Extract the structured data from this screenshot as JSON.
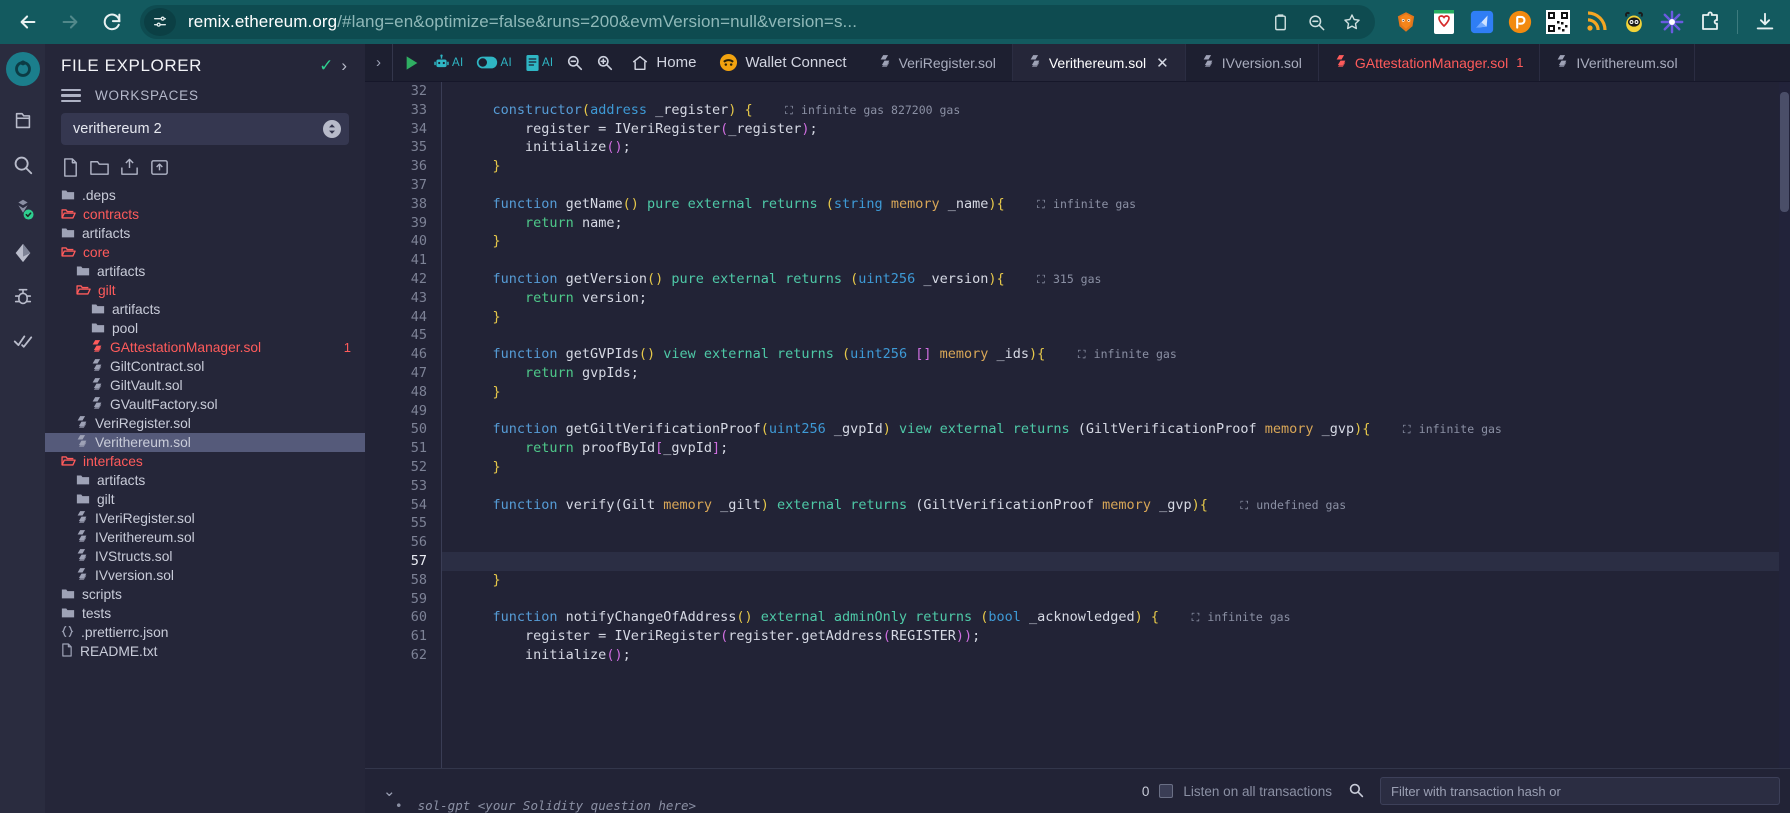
{
  "browser": {
    "back_icon": "back-arrow",
    "forward_icon": "forward-arrow",
    "reload_icon": "reload",
    "site_info_icon": "site-settings",
    "url_domain": "remix.ethereum.org",
    "url_path": "/#lang=en&optimize=false&runs=200&evmVersion=null&version=s...",
    "copy_icon": "clipboard",
    "zoom_icon": "zoom-out-magnifier",
    "bookmark_icon": "star",
    "extensions": [
      {
        "name": "metamask-extension",
        "glyph": "🦊"
      },
      {
        "name": "rabby-wallet-extension",
        "glyph": "🛡"
      },
      {
        "name": "bluefin-extension",
        "glyph": "➤"
      },
      {
        "name": "phantom-wallet-extension",
        "glyph": "℗"
      },
      {
        "name": "qr-code-extension",
        "glyph": "▓"
      },
      {
        "name": "rss-feed-extension",
        "glyph": "◔"
      },
      {
        "name": "bee-extension",
        "glyph": "🐝"
      },
      {
        "name": "asterisk-extension",
        "glyph": "✳"
      },
      {
        "name": "puzzle-extensions-menu",
        "glyph": "⧉"
      }
    ],
    "download_icon": "download"
  },
  "rail": {
    "items": [
      {
        "name": "remix-logo",
        "label": ""
      },
      {
        "name": "file-explorer-icon",
        "label": ""
      },
      {
        "name": "search-icon",
        "label": ""
      },
      {
        "name": "solidity-compiler-icon",
        "label": ""
      },
      {
        "name": "deploy-run-icon",
        "label": ""
      },
      {
        "name": "debugger-icon",
        "label": ""
      },
      {
        "name": "solidity-unit-testing-icon",
        "label": ""
      }
    ]
  },
  "explorer": {
    "title": "FILE EXPLORER",
    "check_icon": "check",
    "expand_icon": "chevron-right",
    "workspaces_label": "WORKSPACES",
    "workspace_selected": "verithereum 2",
    "actions": [
      {
        "name": "create-new-file-icon"
      },
      {
        "name": "create-new-folder-icon"
      },
      {
        "name": "publish-to-gist-icon"
      },
      {
        "name": "upload-file-icon"
      }
    ],
    "tree": [
      {
        "label": ".deps",
        "type": "folder",
        "depth": 0,
        "open": false,
        "state": "closed"
      },
      {
        "label": "contracts",
        "type": "folder",
        "depth": 0,
        "open": true,
        "state": "open"
      },
      {
        "label": "artifacts",
        "type": "folder",
        "depth": 1,
        "open": false,
        "state": "closed"
      },
      {
        "label": "core",
        "type": "folder",
        "depth": 1,
        "open": true,
        "state": "open"
      },
      {
        "label": "artifacts",
        "type": "folder",
        "depth": 2,
        "open": false,
        "state": "closed"
      },
      {
        "label": "gilt",
        "type": "folder",
        "depth": 2,
        "open": true,
        "state": "open"
      },
      {
        "label": "artifacts",
        "type": "folder",
        "depth": 3,
        "open": false,
        "state": "closed"
      },
      {
        "label": "pool",
        "type": "folder",
        "depth": 3,
        "open": false,
        "state": "closed"
      },
      {
        "label": "GAttestationManager.sol",
        "type": "sol",
        "depth": 3,
        "error": true,
        "badge": "1"
      },
      {
        "label": "GiltContract.sol",
        "type": "sol",
        "depth": 3
      },
      {
        "label": "GiltVault.sol",
        "type": "sol",
        "depth": 3
      },
      {
        "label": "GVaultFactory.sol",
        "type": "sol",
        "depth": 3
      },
      {
        "label": "VeriRegister.sol",
        "type": "sol",
        "depth": 2
      },
      {
        "label": "Verithereum.sol",
        "type": "sol",
        "depth": 2,
        "selected": true
      },
      {
        "label": "interfaces",
        "type": "folder",
        "depth": 1,
        "open": true,
        "state": "open"
      },
      {
        "label": "artifacts",
        "type": "folder",
        "depth": 2,
        "open": false,
        "state": "closed"
      },
      {
        "label": "gilt",
        "type": "folder",
        "depth": 2,
        "open": false,
        "state": "closed"
      },
      {
        "label": "IVeriRegister.sol",
        "type": "sol",
        "depth": 2
      },
      {
        "label": "IVerithereum.sol",
        "type": "sol",
        "depth": 2
      },
      {
        "label": "IVStructs.sol",
        "type": "sol",
        "depth": 2
      },
      {
        "label": "IVversion.sol",
        "type": "sol",
        "depth": 2
      },
      {
        "label": "scripts",
        "type": "folder",
        "depth": 0,
        "open": false,
        "state": "closed"
      },
      {
        "label": "tests",
        "type": "folder",
        "depth": 0,
        "open": false,
        "state": "closed"
      },
      {
        "label": ".prettierrc.json",
        "type": "json",
        "depth": 0
      },
      {
        "label": "README.txt",
        "type": "txt",
        "depth": 0
      }
    ]
  },
  "toolbar": {
    "panel_toggle_icon": "chevron-right",
    "run_label": "",
    "buttons": [
      {
        "name": "run-script-button",
        "icon": "play",
        "label": ""
      },
      {
        "name": "ai-explain-button",
        "icon": "robot",
        "label": "AI"
      },
      {
        "name": "ai-toggle-button",
        "icon": "toggle",
        "label": "AI"
      },
      {
        "name": "ai-docs-button",
        "icon": "book",
        "label": "AI"
      },
      {
        "name": "zoom-out-button",
        "icon": "zoom-out",
        "label": ""
      },
      {
        "name": "zoom-in-button",
        "icon": "zoom-in",
        "label": ""
      }
    ],
    "home_label": "Home",
    "wallet_connect_label": "Wallet Connect"
  },
  "tabs": [
    {
      "label": "VeriRegister.sol",
      "active": false,
      "error": false,
      "closable": false
    },
    {
      "label": "Verithereum.sol",
      "active": true,
      "error": false,
      "closable": true
    },
    {
      "label": "IVversion.sol",
      "active": false,
      "error": false,
      "closable": false
    },
    {
      "label": "GAttestationManager.sol",
      "active": false,
      "error": true,
      "closable": false,
      "badge": "1"
    },
    {
      "label": "IVerithereum.sol",
      "active": false,
      "error": false,
      "closable": false
    }
  ],
  "editor": {
    "first_line": 32,
    "current_line": 57,
    "lines": [
      {
        "n": 32,
        "tokens": []
      },
      {
        "n": 33,
        "tokens": [
          {
            "t": "    ",
            "c": "w"
          },
          {
            "t": "constructor",
            "c": "k"
          },
          {
            "t": "(",
            "c": "y"
          },
          {
            "t": "address",
            "c": "ty"
          },
          {
            "t": " _register",
            "c": "w"
          },
          {
            "t": ")",
            "c": "y"
          },
          {
            "t": " {",
            "c": "y"
          }
        ],
        "gas": "infinite gas 827200 gas"
      },
      {
        "n": 34,
        "tokens": [
          {
            "t": "        register ",
            "c": "w"
          },
          {
            "t": "= ",
            "c": "w"
          },
          {
            "t": "IVeriRegister",
            "c": "fn"
          },
          {
            "t": "(",
            "c": "p"
          },
          {
            "t": "_register",
            "c": "w"
          },
          {
            "t": ")",
            "c": "p"
          },
          {
            "t": ";",
            "c": "w"
          }
        ]
      },
      {
        "n": 35,
        "tokens": [
          {
            "t": "        initialize",
            "c": "w"
          },
          {
            "t": "()",
            "c": "p"
          },
          {
            "t": ";",
            "c": "w"
          }
        ]
      },
      {
        "n": 36,
        "tokens": [
          {
            "t": "    }",
            "c": "y"
          }
        ]
      },
      {
        "n": 37,
        "tokens": []
      },
      {
        "n": 38,
        "tokens": [
          {
            "t": "    ",
            "c": "w"
          },
          {
            "t": "function",
            "c": "k"
          },
          {
            "t": " getName",
            "c": "w"
          },
          {
            "t": "()",
            "c": "y"
          },
          {
            "t": " pure external returns ",
            "c": "kw"
          },
          {
            "t": "(",
            "c": "y"
          },
          {
            "t": "string",
            "c": "ty"
          },
          {
            "t": " memory",
            "c": "str"
          },
          {
            "t": " _name",
            "c": "w"
          },
          {
            "t": "){",
            "c": "y"
          }
        ],
        "gas": "infinite gas"
      },
      {
        "n": 39,
        "tokens": [
          {
            "t": "        ",
            "c": "w"
          },
          {
            "t": "return",
            "c": "g"
          },
          {
            "t": " name;",
            "c": "w"
          }
        ]
      },
      {
        "n": 40,
        "tokens": [
          {
            "t": "    }",
            "c": "y"
          }
        ]
      },
      {
        "n": 41,
        "tokens": []
      },
      {
        "n": 42,
        "tokens": [
          {
            "t": "    ",
            "c": "w"
          },
          {
            "t": "function",
            "c": "k"
          },
          {
            "t": " getVersion",
            "c": "w"
          },
          {
            "t": "()",
            "c": "y"
          },
          {
            "t": " pure external returns ",
            "c": "kw"
          },
          {
            "t": "(",
            "c": "y"
          },
          {
            "t": "uint256",
            "c": "ty"
          },
          {
            "t": " _version",
            "c": "w"
          },
          {
            "t": "){",
            "c": "y"
          }
        ],
        "gas": "315 gas"
      },
      {
        "n": 43,
        "tokens": [
          {
            "t": "        ",
            "c": "w"
          },
          {
            "t": "return",
            "c": "g"
          },
          {
            "t": " version;",
            "c": "w"
          }
        ]
      },
      {
        "n": 44,
        "tokens": [
          {
            "t": "    }",
            "c": "y"
          }
        ]
      },
      {
        "n": 45,
        "tokens": []
      },
      {
        "n": 46,
        "tokens": [
          {
            "t": "    ",
            "c": "w"
          },
          {
            "t": "function",
            "c": "k"
          },
          {
            "t": " getGVPIds",
            "c": "w"
          },
          {
            "t": "()",
            "c": "y"
          },
          {
            "t": " view external returns ",
            "c": "kw"
          },
          {
            "t": "(",
            "c": "y"
          },
          {
            "t": "uint256",
            "c": "ty"
          },
          {
            "t": " ",
            "c": "w"
          },
          {
            "t": "[]",
            "c": "p"
          },
          {
            "t": " memory",
            "c": "str"
          },
          {
            "t": " _ids",
            "c": "w"
          },
          {
            "t": "){",
            "c": "y"
          }
        ],
        "gas": "infinite gas"
      },
      {
        "n": 47,
        "tokens": [
          {
            "t": "        ",
            "c": "w"
          },
          {
            "t": "return",
            "c": "g"
          },
          {
            "t": " gvpIds;",
            "c": "w"
          }
        ]
      },
      {
        "n": 48,
        "tokens": [
          {
            "t": "    }",
            "c": "y"
          }
        ]
      },
      {
        "n": 49,
        "tokens": []
      },
      {
        "n": 50,
        "tokens": [
          {
            "t": "    ",
            "c": "w"
          },
          {
            "t": "function",
            "c": "k"
          },
          {
            "t": " getGiltVerificationProof",
            "c": "w"
          },
          {
            "t": "(",
            "c": "y"
          },
          {
            "t": "uint256",
            "c": "ty"
          },
          {
            "t": " _gvpId",
            "c": "w"
          },
          {
            "t": ")",
            "c": "y"
          },
          {
            "t": " view external returns ",
            "c": "kw"
          },
          {
            "t": "(GiltVerificationProof",
            "c": "w"
          },
          {
            "t": " memory",
            "c": "str"
          },
          {
            "t": " _gvp",
            "c": "w"
          },
          {
            "t": "){",
            "c": "y"
          }
        ],
        "gas": "infinite gas"
      },
      {
        "n": 51,
        "tokens": [
          {
            "t": "        ",
            "c": "w"
          },
          {
            "t": "return",
            "c": "g"
          },
          {
            "t": " proofById",
            "c": "w"
          },
          {
            "t": "[",
            "c": "p"
          },
          {
            "t": "_gvpId",
            "c": "w"
          },
          {
            "t": "]",
            "c": "p"
          },
          {
            "t": ";",
            "c": "w"
          }
        ]
      },
      {
        "n": 52,
        "tokens": [
          {
            "t": "    }",
            "c": "y"
          }
        ]
      },
      {
        "n": 53,
        "tokens": []
      },
      {
        "n": 54,
        "tokens": [
          {
            "t": "    ",
            "c": "w"
          },
          {
            "t": "function",
            "c": "k"
          },
          {
            "t": " verify",
            "c": "w"
          },
          {
            "t": "(Gilt",
            "c": "w"
          },
          {
            "t": " memory",
            "c": "str"
          },
          {
            "t": " _gilt",
            "c": "w"
          },
          {
            "t": ")",
            "c": "y"
          },
          {
            "t": " external returns ",
            "c": "kw"
          },
          {
            "t": "(GiltVerificationProof",
            "c": "w"
          },
          {
            "t": " memory",
            "c": "str"
          },
          {
            "t": " _gvp",
            "c": "w"
          },
          {
            "t": "){",
            "c": "y"
          }
        ],
        "gas": "undefined gas"
      },
      {
        "n": 55,
        "tokens": []
      },
      {
        "n": 56,
        "tokens": []
      },
      {
        "n": 57,
        "tokens": [],
        "current": true
      },
      {
        "n": 58,
        "tokens": [
          {
            "t": "    }",
            "c": "y"
          }
        ]
      },
      {
        "n": 59,
        "tokens": []
      },
      {
        "n": 60,
        "tokens": [
          {
            "t": "    ",
            "c": "w"
          },
          {
            "t": "function",
            "c": "k"
          },
          {
            "t": " notifyChangeOfAddress",
            "c": "w"
          },
          {
            "t": "()",
            "c": "y"
          },
          {
            "t": " external adminOnly returns ",
            "c": "kw"
          },
          {
            "t": "(",
            "c": "y"
          },
          {
            "t": "bool",
            "c": "ty"
          },
          {
            "t": " _acknowledged",
            "c": "w"
          },
          {
            "t": ") {",
            "c": "y"
          }
        ],
        "gas": "infinite gas"
      },
      {
        "n": 61,
        "tokens": [
          {
            "t": "        register ",
            "c": "w"
          },
          {
            "t": "= ",
            "c": "w"
          },
          {
            "t": "IVeriRegister",
            "c": "fn"
          },
          {
            "t": "(",
            "c": "p"
          },
          {
            "t": "register.getAddress",
            "c": "w"
          },
          {
            "t": "(",
            "c": "p"
          },
          {
            "t": "REGISTER",
            "c": "w"
          },
          {
            "t": "))",
            "c": "p"
          },
          {
            "t": ";",
            "c": "w"
          }
        ]
      },
      {
        "n": 62,
        "tokens": [
          {
            "t": "        initialize",
            "c": "w"
          },
          {
            "t": "()",
            "c": "p"
          },
          {
            "t": ";",
            "c": "w"
          }
        ]
      }
    ]
  },
  "terminal": {
    "collapse_icon": "chevron-down",
    "count": "0",
    "listen_label": "Listen on all transactions",
    "search_icon": "search",
    "filter_placeholder": "Filter with transaction hash or",
    "hint_text": "sol-gpt <your Solidity question here>"
  }
}
